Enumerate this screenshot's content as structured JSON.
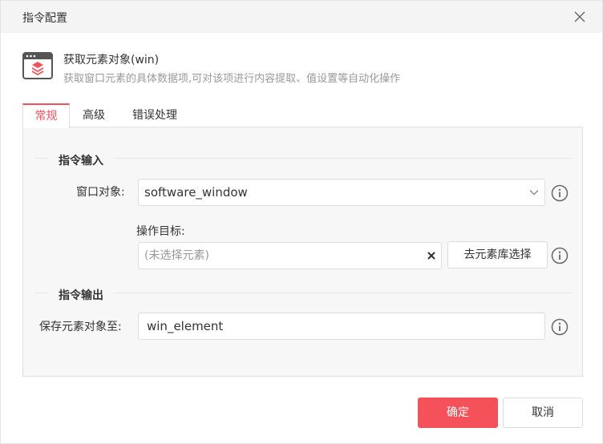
{
  "dialog": {
    "title": "指令配置",
    "close_icon": "close-icon"
  },
  "command": {
    "icon": "window-element-icon",
    "name": "获取元素对象(win)",
    "description": "获取窗口元素的具体数据项,可对该项进行内容提取、值设置等自动化操作"
  },
  "tabs": [
    {
      "label": "常规",
      "active": true
    },
    {
      "label": "高级",
      "active": false
    },
    {
      "label": "错误处理",
      "active": false
    }
  ],
  "input_section": {
    "title": "指令输入",
    "window_object": {
      "label": "窗口对象:",
      "value": "software_window"
    },
    "target": {
      "label": "操作目标:",
      "placeholder": "(未选择元素)",
      "library_button": "去元素库选择"
    }
  },
  "output_section": {
    "title": "指令输出",
    "save_to": {
      "label": "保存元素对象至:",
      "value": "win_element"
    }
  },
  "footer": {
    "confirm": "确定",
    "cancel": "取消"
  },
  "colors": {
    "accent": "#f4515b",
    "panel_bg": "#f7f7f7",
    "title_bg": "#f4f4f4"
  }
}
